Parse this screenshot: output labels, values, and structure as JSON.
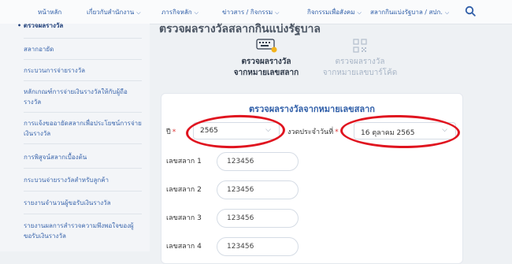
{
  "nav": {
    "items": [
      {
        "label": "หน้าหลัก",
        "chevron": false
      },
      {
        "label": "เกี่ยวกับสำนักงาน",
        "chevron": true
      },
      {
        "label": "ภารกิจหลัก",
        "chevron": true
      },
      {
        "label": "ข่าวสาร / กิจกรรม",
        "chevron": true
      },
      {
        "label": "กิจกรรมเพื่อสังคม",
        "chevron": true
      },
      {
        "label": "สลากกินแบ่งรัฐบาล / สปก.",
        "chevron": true
      }
    ],
    "search_icon": "search-icon"
  },
  "sidebar": {
    "items": [
      {
        "label": "• ตรวจผลรางวัล",
        "active": true
      },
      {
        "label": "สลากอายัด",
        "active": false
      },
      {
        "label": "กระบวนการจ่ายรางวัล",
        "active": false
      },
      {
        "label": "หลักเกณฑ์การจ่ายเงินรางวัลให้กับผู้ถือรางวัล",
        "active": false
      },
      {
        "label": "การแจ้งขออายัดสลากเพื่อประโยชน์การจ่ายเงินรางวัล",
        "active": false
      },
      {
        "label": "การพิสูจน์สลากเบื้องต้น",
        "active": false
      },
      {
        "label": "กระบวนจ่ายรางวัลสำหรับลูกค้า",
        "active": false
      },
      {
        "label": "รายงานจำนวนผู้ขอรับเงินรางวัล",
        "active": false
      },
      {
        "label": "รายงานผลการสำรวจความพึงพอใจของผู้ขอรับเงินรางวัล",
        "active": false
      }
    ]
  },
  "main": {
    "page_title": "ตรวจผลรางวัลสลากกินแบ่งรัฐบาล",
    "modes": [
      {
        "line1": "ตรวจผลรางวัล",
        "line2": "จากหมายเลขสลาก",
        "active": true,
        "icon": "keyboard-icon"
      },
      {
        "line1": "ตรวจผลรางวัล",
        "line2": "จากหมายเลขบาร์โค้ด",
        "active": false,
        "icon": "qr-code-icon"
      }
    ],
    "form": {
      "title": "ตรวจผลรางวัลจากหมายเลขสลาก",
      "year_label": "ปี",
      "year_value": "2565",
      "date_label": "งวดประจำวันที่",
      "date_value": "16 ตุลาคม 2565",
      "required_mark": "*",
      "numbers": [
        {
          "label": "เลขสลาก 1",
          "value": "123456"
        },
        {
          "label": "เลขสลาก 2",
          "value": "123456"
        },
        {
          "label": "เลขสลาก 3",
          "value": "123456"
        },
        {
          "label": "เลขสลาก 4",
          "value": "123456"
        }
      ]
    }
  },
  "colors": {
    "accent": "#2f5ea8",
    "annotation": "#e0141f",
    "required": "#dd3333"
  }
}
